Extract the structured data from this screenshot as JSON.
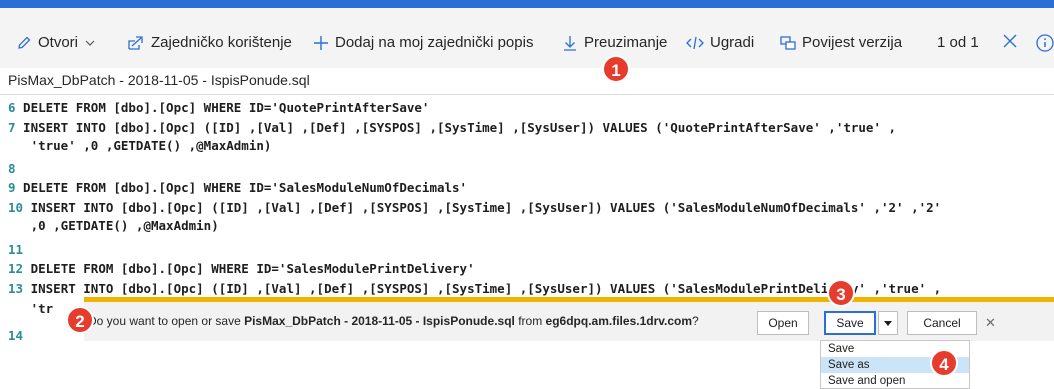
{
  "toolbar": {
    "open_label": "Otvori",
    "share_label": "Zajedničko korištenje",
    "add_label": "Dodaj na moj zajednički popis",
    "download_label": "Preuzimanje",
    "embed_label": "Ugradi",
    "version_label": "Povijest verzija",
    "page_count": "1 od 1"
  },
  "breadcrumb": "PisMax_DbPatch - 2018-11-05 - IspisPonude.sql",
  "code_lines": [
    {
      "num": "6",
      "text": " DELETE FROM [dbo].[Opc] WHERE ID='QuotePrintAfterSave'"
    },
    {
      "num": "7",
      "text": " INSERT INTO [dbo].[Opc] ([ID] ,[Val] ,[Def] ,[SYSPOS] ,[SysTime] ,[SysUser]) VALUES ('QuotePrintAfterSave' ,'true' ,"
    },
    {
      "num": "",
      "text": "   'true' ,0 ,GETDATE() ,@MaxAdmin)"
    },
    {
      "num": "8",
      "text": ""
    },
    {
      "num": "9",
      "text": " DELETE FROM [dbo].[Opc] WHERE ID='SalesModuleNumOfDecimals'"
    },
    {
      "num": "10",
      "text": " INSERT INTO [dbo].[Opc] ([ID] ,[Val] ,[Def] ,[SYSPOS] ,[SysTime] ,[SysUser]) VALUES ('SalesModuleNumOfDecimals' ,'2' ,'2'"
    },
    {
      "num": "",
      "text": "   ,0 ,GETDATE() ,@MaxAdmin)"
    },
    {
      "num": "11",
      "text": ""
    },
    {
      "num": "12",
      "text": " DELETE FROM [dbo].[Opc] WHERE ID='SalesModulePrintDelivery'"
    },
    {
      "num": "13",
      "text": " INSERT INTO [dbo].[Opc] ([ID] ,[Val] ,[Def] ,[SYSPOS] ,[SysTime] ,[SysUser]) VALUES ('SalesModulePrintDelivery' ,'true' ,"
    },
    {
      "num": "",
      "text": "   'tr"
    },
    {
      "num": "14",
      "text": ""
    }
  ],
  "download_bar": {
    "prefix": "Do you want to open or save ",
    "filename": "PisMax_DbPatch - 2018-11-05 - IspisPonude.sql",
    "middle": " from ",
    "host": "eg6dpq.am.files.1drv.com",
    "suffix": "?",
    "open_label": "Open",
    "save_label": "Save",
    "cancel_label": "Cancel"
  },
  "save_menu": [
    "Save",
    "Save as",
    "Save and open"
  ],
  "badges": [
    "1",
    "2",
    "3",
    "4"
  ],
  "colors": {
    "accent": "#2b6fd6",
    "badge": "#e53c2e",
    "notify_border": "#f0b400",
    "line_number": "#2b8c9c"
  }
}
